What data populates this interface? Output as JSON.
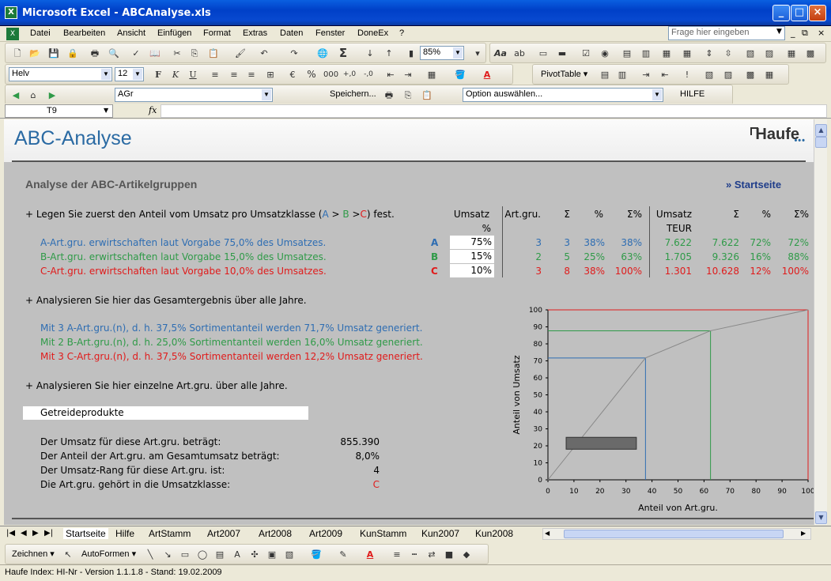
{
  "window": {
    "title": "Microsoft Excel - ABCAnalyse.xls"
  },
  "menu": {
    "items": [
      "Datei",
      "Bearbeiten",
      "Ansicht",
      "Einfügen",
      "Format",
      "Extras",
      "Daten",
      "Fenster",
      "DoneEx",
      "?"
    ],
    "help_placeholder": "Frage hier eingeben"
  },
  "toolbar": {
    "zoom": "85%",
    "font": "Helv",
    "size": "12",
    "pivot": "PivotTable ▾"
  },
  "toolbar3": {
    "combo": "AGr",
    "save": "Speichern...",
    "option": "Option auswählen...",
    "help": "HILFE"
  },
  "formula": {
    "cell": "T9",
    "fx": "fx"
  },
  "page": {
    "title": "ABC-Analyse",
    "logo": "Haufe",
    "subtitle": "Analyse der ABC-Artikelgruppen",
    "start_link": "» Startseite"
  },
  "section1": {
    "instruction_pre": "+ Legen Sie zuerst den Anteil vom Umsatz pro Umsatzklasse (",
    "inst_a": "A",
    " ": " ",
    "gt1": " > ",
    "inst_b": "B",
    "gt2": " >",
    "inst_c": "C",
    "instruction_post": ") fest.",
    "headers": {
      "umsatz": "Umsatz",
      "pct": "%",
      "artgru": "Art.gru.",
      "sigma": "Σ",
      "pct2": "%",
      "sigmapct": "Σ%",
      "umsatz2": "Umsatz",
      "teur": "TEUR",
      "sigma2": "Σ",
      "pct3": "%",
      "sigmapct2": "Σ%"
    },
    "rows": [
      {
        "label": "A-Art.gru. erwirtschaften laut Vorgabe 75,0% des Umsatzes.",
        "cls": "A",
        "input": "75%",
        "artgru": "3",
        "sum": "3",
        "pct": "38%",
        "sumpct": "38%",
        "umsatz": "7.622",
        "sumu": "7.622",
        "pctu": "72%",
        "sumpctu": "72%"
      },
      {
        "label": "B-Art.gru. erwirtschaften laut Vorgabe 15,0% des Umsatzes.",
        "cls": "B",
        "input": "15%",
        "artgru": "2",
        "sum": "5",
        "pct": "25%",
        "sumpct": "63%",
        "umsatz": "1.705",
        "sumu": "9.326",
        "pctu": "16%",
        "sumpctu": "88%"
      },
      {
        "label": "C-Art.gru. erwirtschaften laut Vorgabe 10,0% des Umsatzes.",
        "cls": "C",
        "input": "10%",
        "artgru": "3",
        "sum": "8",
        "pct": "38%",
        "sumpct": "100%",
        "umsatz": "1.301",
        "sumu": "10.628",
        "pctu": "12%",
        "sumpctu": "100%"
      }
    ]
  },
  "section2": {
    "heading": "+ Analysieren Sie hier das Gesamtergebnis über alle Jahre.",
    "line_a": "Mit 3 A-Art.gru.(n), d. h. 37,5% Sortimentanteil werden 71,7% Umsatz generiert.",
    "line_b": "Mit 2 B-Art.gru.(n), d. h. 25,0% Sortimentanteil werden 16,0% Umsatz generiert.",
    "line_c": "Mit 3 C-Art.gru.(n), d. h. 37,5% Sortimentanteil werden 12,2% Umsatz generiert."
  },
  "section3": {
    "heading": "+ Analysieren Sie hier einzelne Art.gru. über alle Jahre.",
    "group": "Getreideprodukte",
    "rows": [
      {
        "label": "Der Umsatz für diese Art.gru. beträgt:",
        "value": "855.390"
      },
      {
        "label": "Der Anteil der Art.gru. am Gesamtumsatz beträgt:",
        "value": "8,0%"
      },
      {
        "label": "Der Umsatz-Rang für diese Art.gru. ist:",
        "value": "4"
      },
      {
        "label": "Die Art.gru. gehört in die Umsatzklasse:",
        "value": "C"
      }
    ]
  },
  "chart_data": {
    "type": "line",
    "xlabel": "Anteil von Art.gru.",
    "ylabel": "Anteil von Umsatz",
    "xlim": [
      0,
      100
    ],
    "ylim": [
      0,
      100
    ],
    "xticks": [
      "0",
      "10",
      "20",
      "30",
      "40",
      "50",
      "60",
      "70",
      "80",
      "90",
      "100"
    ],
    "yticks": [
      "0",
      "10",
      "20",
      "30",
      "40",
      "50",
      "60",
      "70",
      "80",
      "90",
      "100"
    ],
    "series": [
      {
        "x": [
          0,
          37.5,
          62.5,
          100
        ],
        "y": [
          0,
          71.7,
          87.7,
          100
        ]
      }
    ],
    "guides": [
      {
        "x": 37.5,
        "y": 71.7,
        "color": "#2e6db2"
      },
      {
        "x": 62.5,
        "y": 87.7,
        "color": "#2f9a48"
      },
      {
        "x": 100,
        "y": 100,
        "color": "#e01b1b"
      }
    ],
    "highlight": {
      "x0": 7,
      "x1": 34,
      "y0": 18,
      "y1": 25
    }
  },
  "tabs": [
    "Startseite",
    "Hilfe",
    "ArtStamm",
    "Art2007",
    "Art2008",
    "Art2009",
    "KunStamm",
    "Kun2007",
    "Kun2008"
  ],
  "drawbar": {
    "draw": "Zeichnen ▾",
    "autoshapes": "AutoFormen ▾"
  },
  "status": {
    "text": "Haufe Index: HI-Nr - Version 1.1.1.8 - Stand: 19.02.2009"
  }
}
